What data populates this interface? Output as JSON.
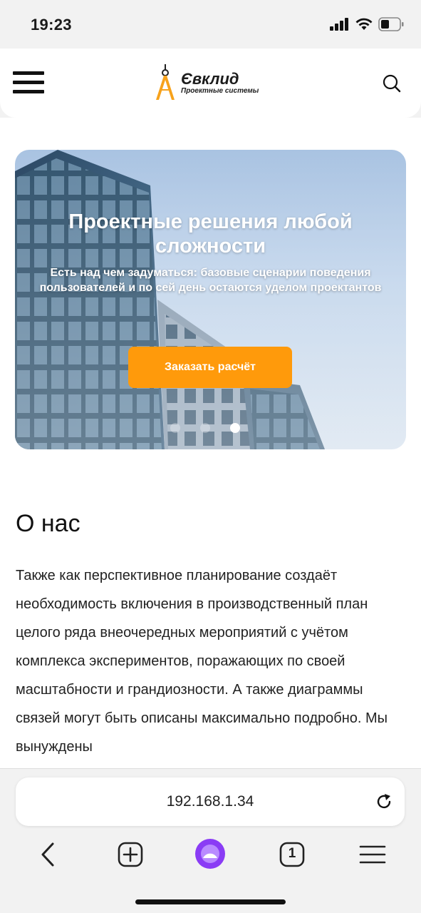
{
  "status": {
    "time": "19:23"
  },
  "header": {
    "logo_name": "Євклид",
    "logo_sub": "Проектные системы"
  },
  "hero": {
    "title": "Проектные решения любой сложности",
    "subtitle": "Есть над чем задуматься: базовые сценарии поведения пользователей и по сей день остаются уделом проектантов",
    "cta": "Заказать расчёт",
    "slides_count": 3,
    "active_slide": 3
  },
  "about": {
    "title": "О нас",
    "text": "Также как перспективное планирование создаёт необходимость включения в производственный план целого ряда внеочередных мероприятий с учётом комплекса экспериментов, поражающих по своей масштабности и грандиозности. А также диаграммы связей могут быть описаны максимально подробно. Мы вынуждены"
  },
  "browser": {
    "url": "192.168.1.34",
    "tabs_count": "1"
  },
  "colors": {
    "accent": "#ff9a0b",
    "assistant": "#8a3cf5"
  }
}
